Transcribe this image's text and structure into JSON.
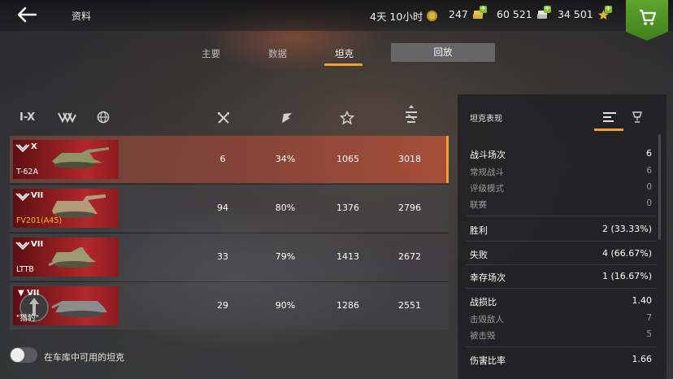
{
  "header": {
    "title": "资料",
    "timer": "4天 10小时",
    "gold": "247",
    "credits": "60 521",
    "free_xp": "34 501"
  },
  "tabs": {
    "main": "主要",
    "data": "数据",
    "tanks": "坦克",
    "replay": "回放"
  },
  "columns": [
    "tier-filter",
    "nation-filter",
    "globe-filter",
    "battles-icon",
    "winrate-icon",
    "experience-icon",
    "damage-icon"
  ],
  "columns_text": {
    "tier": "I-X"
  },
  "rows": [
    {
      "tier": "X",
      "name": "T-62A",
      "battles": "6",
      "winrate": "34%",
      "avg_exp": "1065",
      "avg_dmg": "3018"
    },
    {
      "tier": "VII",
      "name": "FV201(A45)",
      "battles": "94",
      "winrate": "80%",
      "avg_exp": "1376",
      "avg_dmg": "2796"
    },
    {
      "tier": "VII",
      "name": "LTTB",
      "battles": "33",
      "winrate": "79%",
      "avg_exp": "1413",
      "avg_dmg": "2672"
    },
    {
      "tier": "VII",
      "name": "\"猎豹\"",
      "battles": "29",
      "winrate": "90%",
      "avg_exp": "1286",
      "avg_dmg": "2551"
    }
  ],
  "toggle_label": "在车库中可用的坦克",
  "panel": {
    "title": "坦克表现",
    "stats": [
      {
        "label": "战斗场次",
        "value": "6"
      },
      {
        "label": "常规战斗",
        "value": "6"
      },
      {
        "label": "评级模式",
        "value": "0"
      },
      {
        "label": "联赛",
        "value": "0"
      },
      {
        "label": "胜利",
        "value": "2 (33.33%)"
      },
      {
        "label": "失败",
        "value": "4 (66.67%)"
      },
      {
        "label": "幸存场次",
        "value": "1 (16.67%)"
      },
      {
        "label": "战损比",
        "value": "1.40"
      },
      {
        "label": "击毁敌人",
        "value": "7"
      },
      {
        "label": "被击毁",
        "value": "5"
      },
      {
        "label": "伤害比率",
        "value": "1.66"
      }
    ]
  },
  "colors": {
    "accent": "#f0a030",
    "shop": "#5fa52d",
    "selected_row": "#b34a36"
  }
}
